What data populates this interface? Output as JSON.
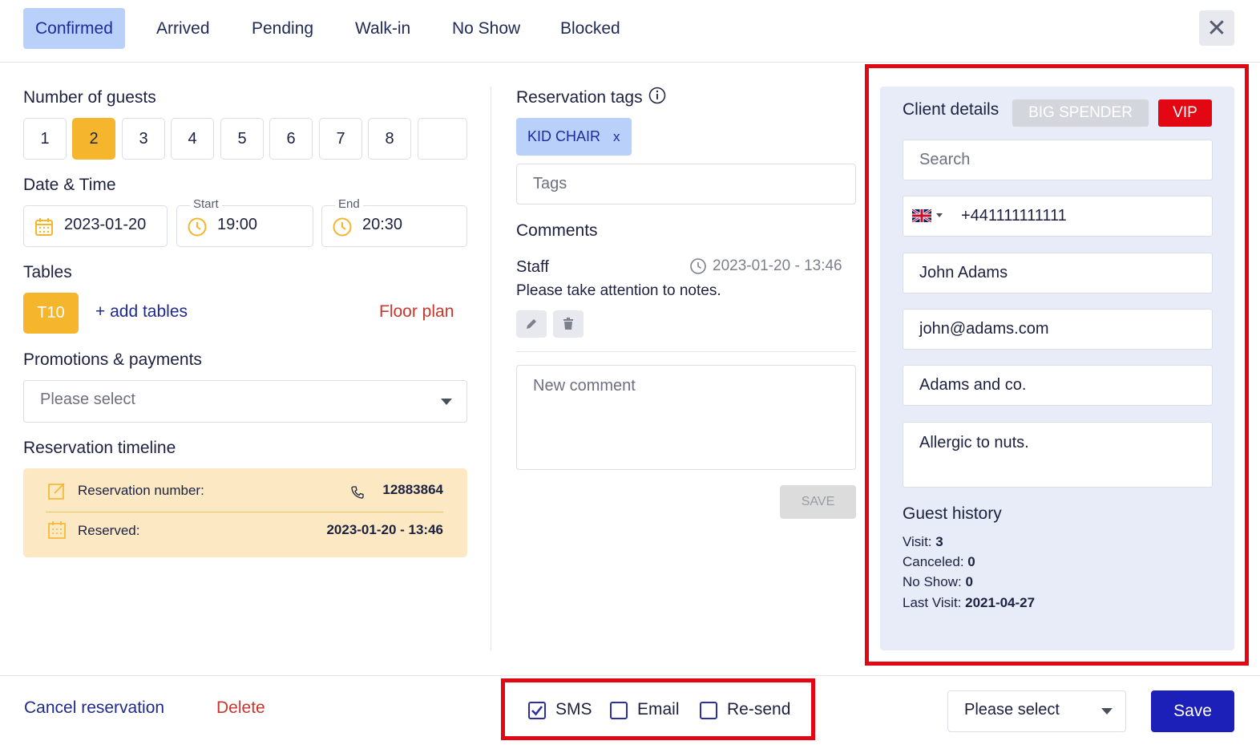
{
  "status_tabs": [
    {
      "label": "Confirmed",
      "active": true
    },
    {
      "label": "Arrived",
      "active": false
    },
    {
      "label": "Pending",
      "active": false
    },
    {
      "label": "Walk-in",
      "active": false
    },
    {
      "label": "No Show",
      "active": false
    },
    {
      "label": "Blocked",
      "active": false
    }
  ],
  "close_label": "✕",
  "guests": {
    "title": "Number of guests",
    "options": [
      "1",
      "2",
      "3",
      "4",
      "5",
      "6",
      "7",
      "8",
      ""
    ],
    "selected": "2"
  },
  "datetime": {
    "title": "Date & Time",
    "date": "2023-01-20",
    "start_label": "Start",
    "start": "19:00",
    "end_label": "End",
    "end": "20:30"
  },
  "tables": {
    "title": "Tables",
    "selected": "T10",
    "add_label": "+ add tables",
    "floor_plan_label": "Floor plan"
  },
  "promotions": {
    "title": "Promotions & payments",
    "placeholder": "Please select"
  },
  "timeline": {
    "title": "Reservation timeline",
    "number_label": "Reservation number:",
    "number_value": "12883864",
    "reserved_label": "Reserved:",
    "reserved_value": "2023-01-20 - 13:46"
  },
  "reservation_tags": {
    "title": "Reservation tags",
    "tags": [
      "KID CHAIR"
    ],
    "remove_label": "x",
    "placeholder": "Tags"
  },
  "comments": {
    "title": "Comments",
    "author": "Staff",
    "timestamp": "2023-01-20 - 13:46",
    "text": "Please take attention to notes.",
    "new_placeholder": "New comment",
    "save_label": "SAVE"
  },
  "client": {
    "title": "Client details",
    "badges": [
      {
        "label": "BIG SPENDER",
        "color": "#d4d6de"
      },
      {
        "label": "VIP",
        "color": "#e30613"
      }
    ],
    "search_placeholder": "Search",
    "phone": "+441111111111",
    "name": "John Adams",
    "email": "john@adams.com",
    "company": "Adams and co.",
    "notes": "Allergic to nuts."
  },
  "guest_history": {
    "title": "Guest history",
    "visit_label": "Visit:",
    "visit": "3",
    "canceled_label": "Canceled:",
    "canceled": "0",
    "noshow_label": "No Show:",
    "noshow": "0",
    "last_visit_label": "Last Visit:",
    "last_visit": "2021-04-27"
  },
  "footer": {
    "cancel_label": "Cancel reservation",
    "delete_label": "Delete",
    "notify": [
      {
        "label": "SMS",
        "checked": true
      },
      {
        "label": "Email",
        "checked": false
      },
      {
        "label": "Re-send",
        "checked": false
      }
    ],
    "select_placeholder": "Please select",
    "save_label": "Save"
  },
  "colors": {
    "accent_blue": "#1c1fb8",
    "tab_active_bg": "#b9d0fb",
    "amber": "#f5b52c",
    "highlight_red": "#e30613",
    "link_red": "#c9362c"
  }
}
